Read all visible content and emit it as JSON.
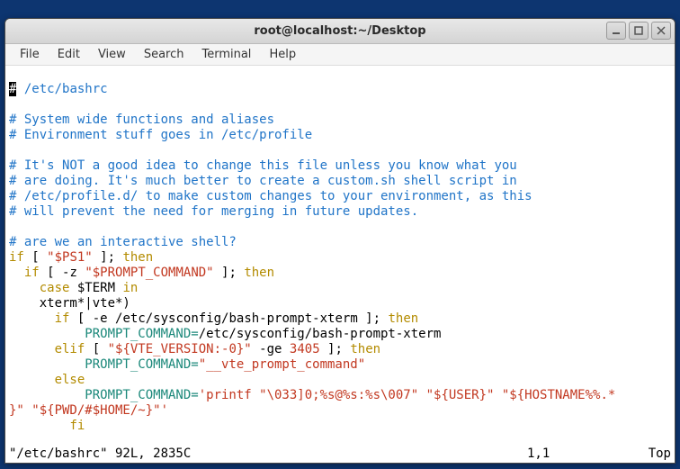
{
  "window": {
    "title": "root@localhost:~/Desktop"
  },
  "menu": {
    "file": "File",
    "edit": "Edit",
    "view": "View",
    "search": "Search",
    "terminal": "Terminal",
    "help": "Help"
  },
  "code": {
    "l1": "# /etc/bashrc",
    "l1_cursor": "#",
    "l1_rest": " /etc/bashrc",
    "l3": "# System wide functions and aliases",
    "l4": "# Environment stuff goes in /etc/profile",
    "l6": "# It's NOT a good idea to change this file unless you know what you",
    "l7": "# are doing. It's much better to create a custom.sh shell script in",
    "l8": "# /etc/profile.d/ to make custom changes to your environment, as this",
    "l9": "# will prevent the need for merging in future updates.",
    "l11": "# are we an interactive shell?",
    "if": "if",
    "then": "then",
    "elif": "elif",
    "else": "else",
    "fi": "fi",
    "case": "case",
    "in": "in",
    "lb": " [ ",
    "rb": " ]; ",
    "ps1": "\"$PS1\"",
    "dashz": "-z ",
    "prompt_cmd": "\"$PROMPT_COMMAND\"",
    "term": " $TERM ",
    "pattern": "    xterm*|vte*)",
    "dashe": "-e ",
    "xpath": "/etc/sysconfig/bash-prompt-xterm",
    "assign_pc": "          PROMPT_COMMAND=",
    "xpath2": "/etc/sysconfig/bash-prompt-xterm",
    "vte": "\"${VTE_VERSION:-0}\"",
    "dashge": " -ge ",
    "n3405": "3405",
    "vtecmd": "\"__vte_prompt_command\"",
    "printf": "'printf \"\\033]0;%s@%s:%s\\007\" \"${USER}\" \"${HOSTNAME%%.*\n}\" \"${PWD/#$HOME/~}\"'",
    "indent_if1": "  ",
    "indent_case": "    ",
    "indent_if2": "      ",
    "indent_elif": "      ",
    "indent_else": "      "
  },
  "status": {
    "file": "\"/etc/bashrc\" 92L, 2835C",
    "pos": "1,1",
    "top": "Top"
  }
}
